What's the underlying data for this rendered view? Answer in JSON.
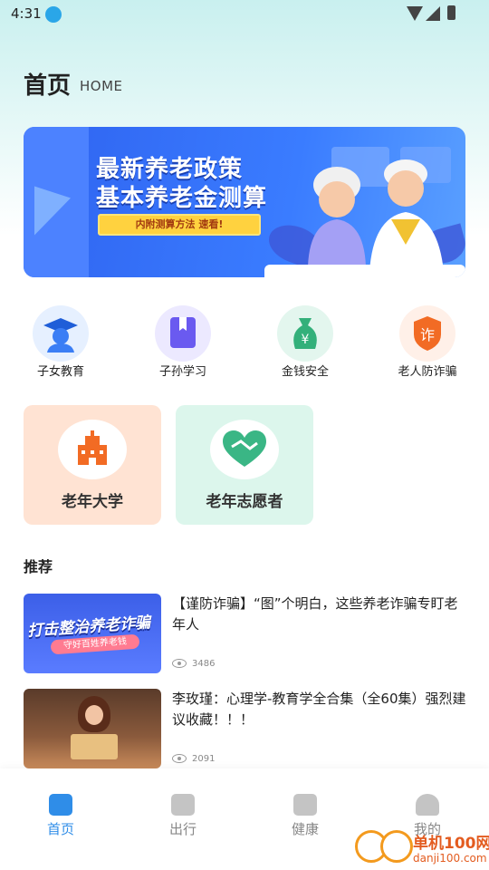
{
  "status_bar": {
    "time": "4:31"
  },
  "header": {
    "title": "首页",
    "subtitle": "HOME"
  },
  "banner": {
    "line1": "最新养老政策",
    "line2": "基本养老金测算",
    "pill": "内附测算方法  速看!"
  },
  "categories": [
    {
      "label": "子女教育",
      "icon": "graduate-icon",
      "bg": "#e6f0ff",
      "color": "#3b7ef5"
    },
    {
      "label": "子孙学习",
      "icon": "bookmark-icon",
      "bg": "#ece9ff",
      "color": "#6a5af0"
    },
    {
      "label": "金钱安全",
      "icon": "money-bag-icon",
      "bg": "#e3f6ee",
      "color": "#33b07a"
    },
    {
      "label": "老人防诈骗",
      "icon": "anti-fraud-shield-icon",
      "bg": "#fff0e8",
      "color": "#f26b24"
    }
  ],
  "big_cards": [
    {
      "label": "老年大学",
      "bg": "#ffe3d3",
      "color": "#f26b24"
    },
    {
      "label": "老年志愿者",
      "bg": "#dcf6ec",
      "color": "#3ab685"
    }
  ],
  "section": {
    "title": "推荐"
  },
  "articles": [
    {
      "title": "【谨防诈骗】“图”个明白，这些养老诈骗专盯老年人",
      "views": "3486",
      "thumb_text": "打击整治养老诈骗",
      "thumb_pill": "守好百姓养老钱"
    },
    {
      "title": "李玫瑾：心理学-教育学全合集（全60集）强烈建议收藏！！！",
      "views": "2091"
    }
  ],
  "bottom_nav": [
    {
      "label": "首页",
      "active": true
    },
    {
      "label": "出行",
      "active": false
    },
    {
      "label": "健康",
      "active": false
    },
    {
      "label": "我的",
      "active": false
    }
  ],
  "watermark": {
    "name": "单机100网",
    "url": "danji100.com"
  }
}
